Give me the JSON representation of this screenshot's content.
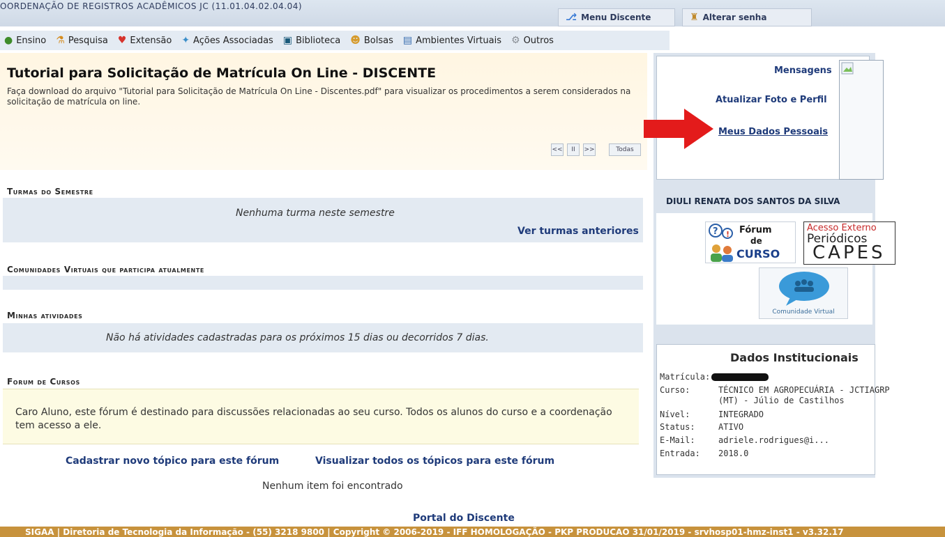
{
  "top": {
    "title": "OORDENAÇÃO DE REGISTROS ACADÊMICOS JC (11.01.04.02.04.04)",
    "menu_discente": "Menu Discente",
    "alterar_senha": "Alterar senha"
  },
  "menu": [
    {
      "label": "Ensino",
      "icon": "book-icon"
    },
    {
      "label": "Pesquisa",
      "icon": "flask-icon"
    },
    {
      "label": "Extensão",
      "icon": "heart-icon"
    },
    {
      "label": "Ações Associadas",
      "icon": "puzzle-icon"
    },
    {
      "label": "Biblioteca",
      "icon": "library-icon"
    },
    {
      "label": "Bolsas",
      "icon": "user-icon"
    },
    {
      "label": "Ambientes Virtuais",
      "icon": "network-icon"
    },
    {
      "label": "Outros",
      "icon": "gear-icon"
    }
  ],
  "notice": {
    "title": "Tutorial para Solicitação de Matrícula On Line - DISCENTE",
    "text": "Faça download do arquivo \"Tutorial para Solicitação de Matrícula On Line - Discentes.pdf\" para visualizar os procedimentos a serem considerados  na solicitação de matrícula on line.",
    "pager": [
      "<<",
      "II",
      ">>",
      "Todas"
    ]
  },
  "turmas": {
    "title": "Turmas do Semestre",
    "empty": "Nenhuma turma neste semestre",
    "link": "Ver turmas anteriores"
  },
  "comunidades": {
    "title": "Comunidades Virtuais que participa atualmente"
  },
  "atividades": {
    "title": "Minhas atividades",
    "empty": "Não há atividades cadastradas para os próximos 15 dias ou decorridos 7 dias."
  },
  "forum": {
    "title": "Forum de Cursos",
    "text": "Caro Aluno, este fórum é destinado para discussões relacionadas ao seu curso. Todos os alunos do curso e a coordenação tem acesso a ele.",
    "new_topic": "Cadastrar novo tópico para este fórum",
    "view_all": "Visualizar todos os tópicos para este fórum",
    "empty": "Nenhum item foi encontrado"
  },
  "profile": {
    "mensagens": "Mensagens",
    "atualizar": "Atualizar Foto e Perfil",
    "dados": "Meus Dados Pessoais",
    "name": "DIULI RENATA DOS SANTOS DA SILVA"
  },
  "logos": {
    "forum_line1": "Fórum",
    "forum_line2": "de",
    "forum_line3": "CURSO",
    "capes_line1": "Acesso Externo",
    "capes_line2": "Periódicos",
    "capes_line3": "CAPES",
    "comunidade": "Comunidade Virtual"
  },
  "institucionais": {
    "title": "Dados Institucionais",
    "matricula_label": "Matrícula:",
    "curso_label": "Curso:",
    "curso_value_1": "TÉCNICO EM AGROPECUÁRIA - JCTIAGRP",
    "curso_value_2": "(MT) - Júlio de Castilhos",
    "nivel_label": "Nível:",
    "nivel_value": "INTEGRADO",
    "status_label": "Status:",
    "status_value": "ATIVO",
    "email_label": "E-Mail:",
    "email_value": "adriele.rodrigues@i...",
    "entrada_label": "Entrada:",
    "entrada_value": "2018.0"
  },
  "portal": "Portal do Discente",
  "footer": "SIGAA | Diretoria de Tecnologia da Informação - (55) 3218 9800 | Copyright © 2006-2019 - IFF HOMOLOGAÇÃO - PKP PRODUCAO 31/01/2019 - srvhosp01-hmz-inst1 - v3.32.17",
  "colors": {
    "link": "#1f3b7a",
    "band": "#e3eaf2",
    "footer": "#c7923c",
    "arrow": "#e31b1b"
  }
}
